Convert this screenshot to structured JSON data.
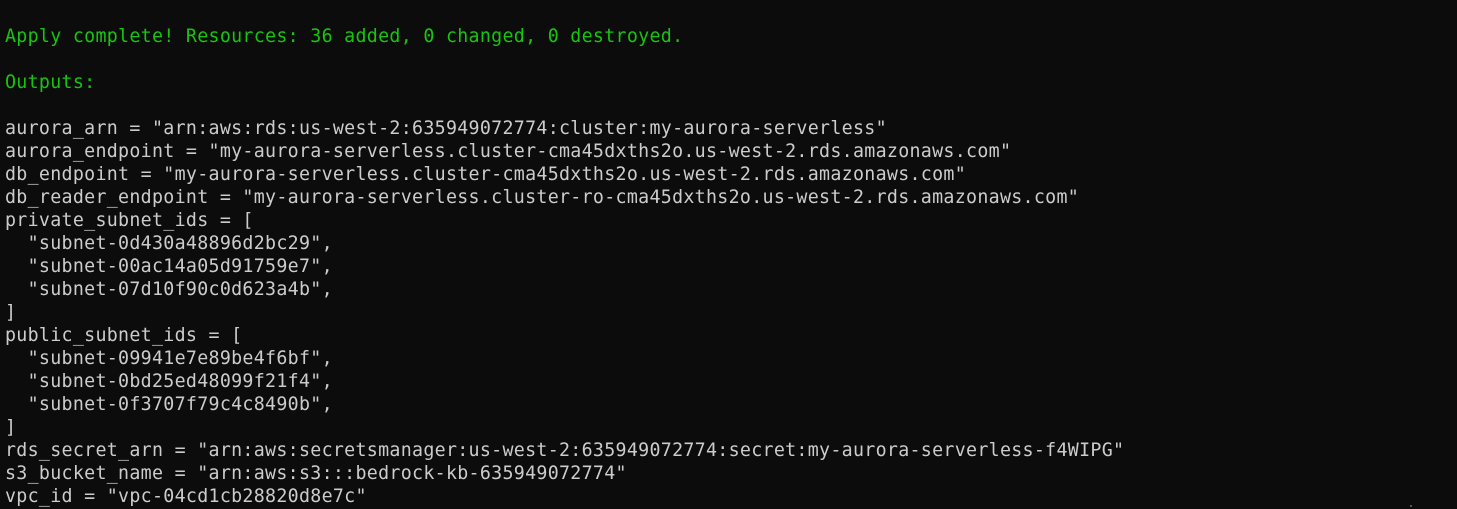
{
  "terminal": {
    "apply_line": "Apply complete! Resources: 36 added, 0 changed, 0 destroyed.",
    "outputs_heading": "Outputs:",
    "outputs": [
      "aurora_arn = \"arn:aws:rds:us-west-2:635949072774:cluster:my-aurora-serverless\"",
      "aurora_endpoint = \"my-aurora-serverless.cluster-cma45dxths2o.us-west-2.rds.amazonaws.com\"",
      "db_endpoint = \"my-aurora-serverless.cluster-cma45dxths2o.us-west-2.rds.amazonaws.com\"",
      "db_reader_endpoint = \"my-aurora-serverless.cluster-ro-cma45dxths2o.us-west-2.rds.amazonaws.com\"",
      "private_subnet_ids = [",
      "  \"subnet-0d430a48896d2bc29\",",
      "  \"subnet-00ac14a05d91759e7\",",
      "  \"subnet-07d10f90c0d623a4b\",",
      "]",
      "public_subnet_ids = [",
      "  \"subnet-09941e7e89be4f6bf\",",
      "  \"subnet-0bd25ed48099f21f4\",",
      "  \"subnet-0f3707f79c4c8490b\",",
      "]",
      "rds_secret_arn = \"arn:aws:secretsmanager:us-west-2:635949072774:secret:my-aurora-serverless-f4WIPG\"",
      "s3_bucket_name = \"arn:aws:s3:::bedrock-kb-635949072774\"",
      "vpc_id = \"vpc-04cd1cb28820d8e7c\""
    ]
  },
  "colors": {
    "background": "#0c0c0c",
    "text": "#cccccc",
    "success": "#16c60c"
  }
}
